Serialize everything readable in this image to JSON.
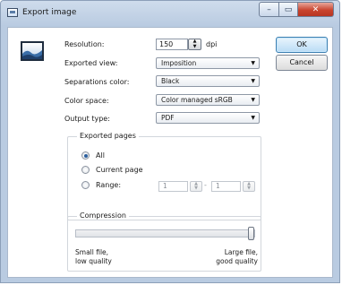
{
  "window": {
    "title": "Export image",
    "minimize_glyph": "–",
    "maximize_glyph": "▭",
    "close_glyph": "✕"
  },
  "form": {
    "resolution": {
      "label": "Resolution:",
      "value": "150",
      "unit": "dpi"
    },
    "exported_view": {
      "label": "Exported view:",
      "value": "Imposition"
    },
    "separations_color": {
      "label": "Separations color:",
      "value": "Black"
    },
    "color_space": {
      "label": "Color space:",
      "value": "Color managed sRGB"
    },
    "output_type": {
      "label": "Output type:",
      "value": "PDF"
    }
  },
  "buttons": {
    "ok": "OK",
    "cancel": "Cancel"
  },
  "exported_pages": {
    "title": "Exported pages",
    "options": [
      {
        "label": "All",
        "checked": true
      },
      {
        "label": "Current page",
        "checked": false
      },
      {
        "label": "Range:",
        "checked": false
      }
    ],
    "range_from": "1",
    "range_separator": "-",
    "range_to": "1"
  },
  "compression": {
    "title": "Compression",
    "level_fraction": 1.0,
    "left_note_line1": "Small file,",
    "left_note_line2": "low quality",
    "right_note_line1": "Large file,",
    "right_note_line2": "good quality"
  },
  "icons": {
    "title": "export-window-icon",
    "image": "export-image-icon",
    "dropdown": "chevron-down-icon"
  },
  "colors": {
    "accent": "#3c7fb1",
    "close": "#c9452f",
    "title_bar": "#b9cbe1"
  }
}
